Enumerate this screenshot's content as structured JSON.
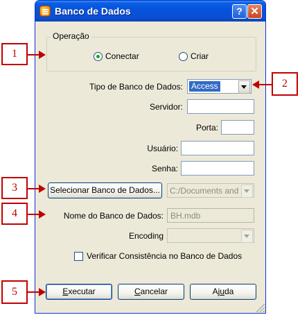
{
  "window": {
    "title": "Banco de Dados",
    "help_glyph": "?",
    "close_glyph": "✕"
  },
  "operation": {
    "legend": "Operação",
    "options": [
      {
        "label": "Conectar",
        "selected": true
      },
      {
        "label": "Criar",
        "selected": false
      }
    ]
  },
  "fields": {
    "db_type_label": "Tipo de Banco de Dados:",
    "db_type_value": "Access",
    "server_label": "Servidor:",
    "server_value": "",
    "port_label": "Porta:",
    "port_value": "",
    "user_label": "Usuário:",
    "user_value": "",
    "password_label": "Senha:",
    "password_value": "",
    "select_db_button": "Selecionar Banco de Dados...",
    "db_path_value": "C:/Documents and Se",
    "db_name_label": "Nome do Banco de Dados:",
    "db_name_value": "BH.mdb",
    "encoding_label": "Encoding",
    "encoding_value": ""
  },
  "check_consistency": {
    "label": "Verificar Consistência no Banco de Dados",
    "checked": false
  },
  "buttons": {
    "execute_mnemonic": "E",
    "execute_rest": "xecutar",
    "cancel_mnemonic": "C",
    "cancel_rest": "ancelar",
    "help_pre": "Aj",
    "help_mnemonic": "u",
    "help_rest": "da"
  },
  "annotations": {
    "a1": "1",
    "a2": "2",
    "a3": "3",
    "a4": "4",
    "a5": "5"
  },
  "colors": {
    "annotation": "#c00000",
    "titlebar": "#0553de",
    "dialog_bg": "#ece9d8"
  }
}
